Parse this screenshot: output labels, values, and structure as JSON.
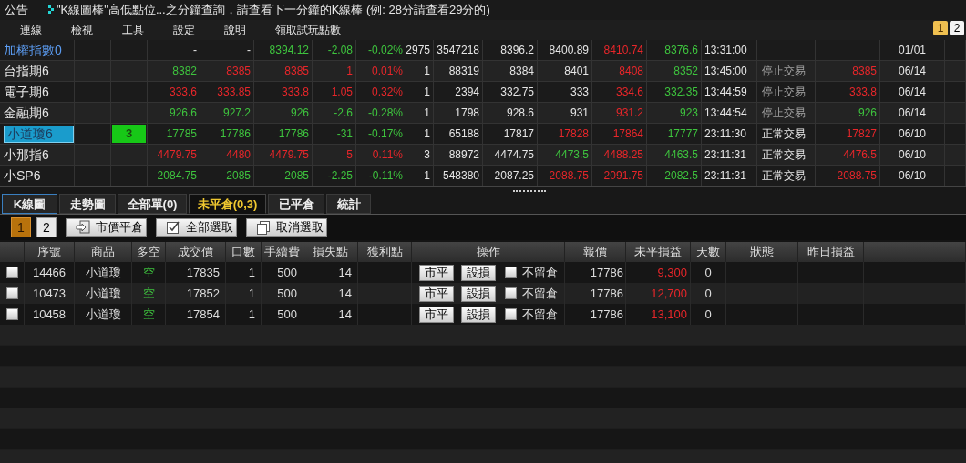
{
  "announcement": {
    "label": "公告",
    "text": "\"K線圖棒\"高低點位...之分鐘查詢，請查看下一分鐘的K線棒 (例: 28分請查看29分的)"
  },
  "menu": [
    "連線",
    "檢視",
    "工具",
    "設定",
    "說明",
    "領取試玩點數"
  ],
  "page_switch": [
    {
      "label": "1",
      "selected": true
    },
    {
      "label": "2",
      "selected": false
    }
  ],
  "quotes": [
    {
      "selected": false,
      "cells": [
        {
          "text": "加權指數0",
          "color": "#5b9bf0"
        },
        null,
        null,
        {
          "text": "-"
        },
        {
          "text": "-"
        },
        {
          "text": "8394.12",
          "color": "#3ec43e"
        },
        {
          "text": "-2.08",
          "color": "#3ec43e"
        },
        {
          "text": "-0.02%",
          "color": "#3ec43e"
        },
        {
          "text": "2975",
          "color": "#e6e6e6"
        },
        {
          "text": "3547218",
          "color": "#e6e6e6"
        },
        {
          "text": "8396.2",
          "color": "#e6e6e6"
        },
        {
          "text": "8400.89",
          "color": "#e6e6e6"
        },
        {
          "text": "8410.74",
          "color": "#e8262a"
        },
        {
          "text": "8376.6",
          "color": "#3ec43e"
        },
        {
          "text": "13:31:00",
          "color": "#e6e6e6"
        },
        null,
        null,
        {
          "text": "01/01",
          "color": "#e6e6e6"
        },
        null
      ]
    },
    {
      "selected": false,
      "cells": [
        {
          "text": "台指期6",
          "color": "#e6e6e6"
        },
        null,
        null,
        {
          "text": "8382",
          "color": "#3ec43e"
        },
        {
          "text": "8385",
          "color": "#e8262a"
        },
        {
          "text": "8385",
          "color": "#e8262a"
        },
        {
          "text": "1",
          "color": "#e8262a"
        },
        {
          "text": "0.01%",
          "color": "#e8262a"
        },
        {
          "text": "1",
          "color": "#e6e6e6"
        },
        {
          "text": "88319",
          "color": "#e6e6e6"
        },
        {
          "text": "8384",
          "color": "#e6e6e6"
        },
        {
          "text": "8401",
          "color": "#e6e6e6"
        },
        {
          "text": "8408",
          "color": "#e8262a"
        },
        {
          "text": "8352",
          "color": "#3ec43e"
        },
        {
          "text": "13:45:00",
          "color": "#e6e6e6"
        },
        {
          "text": "停止交易",
          "color": "#a0a0a0"
        },
        {
          "text": "8385",
          "color": "#e8262a"
        },
        {
          "text": "06/14",
          "color": "#e6e6e6"
        },
        null
      ]
    },
    {
      "selected": false,
      "cells": [
        {
          "text": "電子期6",
          "color": "#e6e6e6"
        },
        null,
        null,
        {
          "text": "333.6",
          "color": "#e8262a"
        },
        {
          "text": "333.85",
          "color": "#e8262a"
        },
        {
          "text": "333.8",
          "color": "#e8262a"
        },
        {
          "text": "1.05",
          "color": "#e8262a"
        },
        {
          "text": "0.32%",
          "color": "#e8262a"
        },
        {
          "text": "1",
          "color": "#e6e6e6"
        },
        {
          "text": "2394",
          "color": "#e6e6e6"
        },
        {
          "text": "332.75",
          "color": "#e6e6e6"
        },
        {
          "text": "333",
          "color": "#e6e6e6"
        },
        {
          "text": "334.6",
          "color": "#e8262a"
        },
        {
          "text": "332.35",
          "color": "#3ec43e"
        },
        {
          "text": "13:44:59",
          "color": "#e6e6e6"
        },
        {
          "text": "停止交易",
          "color": "#a0a0a0"
        },
        {
          "text": "333.8",
          "color": "#e8262a"
        },
        {
          "text": "06/14",
          "color": "#e6e6e6"
        },
        null
      ]
    },
    {
      "selected": false,
      "cells": [
        {
          "text": "金融期6",
          "color": "#e6e6e6"
        },
        null,
        null,
        {
          "text": "926.6",
          "color": "#3ec43e"
        },
        {
          "text": "927.2",
          "color": "#3ec43e"
        },
        {
          "text": "926",
          "color": "#3ec43e"
        },
        {
          "text": "-2.6",
          "color": "#3ec43e"
        },
        {
          "text": "-0.28%",
          "color": "#3ec43e"
        },
        {
          "text": "1",
          "color": "#e6e6e6"
        },
        {
          "text": "1798",
          "color": "#e6e6e6"
        },
        {
          "text": "928.6",
          "color": "#e6e6e6"
        },
        {
          "text": "931",
          "color": "#e6e6e6"
        },
        {
          "text": "931.2",
          "color": "#e8262a"
        },
        {
          "text": "923",
          "color": "#3ec43e"
        },
        {
          "text": "13:44:54",
          "color": "#e6e6e6"
        },
        {
          "text": "停止交易",
          "color": "#a0a0a0"
        },
        {
          "text": "926",
          "color": "#3ec43e"
        },
        {
          "text": "06/14",
          "color": "#e6e6e6"
        },
        null
      ]
    },
    {
      "selected": true,
      "cells": [
        {
          "text": "小道瓊6"
        },
        null,
        {
          "text": "3",
          "kind": "badge"
        },
        {
          "text": "17785",
          "color": "#3ec43e"
        },
        {
          "text": "17786",
          "color": "#3ec43e"
        },
        {
          "text": "17786",
          "color": "#3ec43e"
        },
        {
          "text": "-31",
          "color": "#3ec43e"
        },
        {
          "text": "-0.17%",
          "color": "#3ec43e"
        },
        {
          "text": "1",
          "color": "#e6e6e6"
        },
        {
          "text": "65188",
          "color": "#e6e6e6"
        },
        {
          "text": "17817",
          "color": "#e6e6e6"
        },
        {
          "text": "17828",
          "color": "#e8262a"
        },
        {
          "text": "17864",
          "color": "#e8262a"
        },
        {
          "text": "17777",
          "color": "#3ec43e"
        },
        {
          "text": "23:11:30",
          "color": "#e6e6e6"
        },
        {
          "text": "正常交易"
        },
        {
          "text": "17827",
          "color": "#e8262a"
        },
        {
          "text": "06/10",
          "color": "#e6e6e6"
        },
        null
      ]
    },
    {
      "selected": false,
      "cells": [
        {
          "text": "小那指6",
          "color": "#e6e6e6"
        },
        null,
        null,
        {
          "text": "4479.75",
          "color": "#e8262a"
        },
        {
          "text": "4480",
          "color": "#e8262a"
        },
        {
          "text": "4479.75",
          "color": "#e8262a"
        },
        {
          "text": "5",
          "color": "#e8262a"
        },
        {
          "text": "0.11%",
          "color": "#e8262a"
        },
        {
          "text": "3",
          "color": "#e6e6e6"
        },
        {
          "text": "88972",
          "color": "#e6e6e6"
        },
        {
          "text": "4474.75",
          "color": "#e6e6e6"
        },
        {
          "text": "4473.5",
          "color": "#3ec43e"
        },
        {
          "text": "4488.25",
          "color": "#e8262a"
        },
        {
          "text": "4463.5",
          "color": "#3ec43e"
        },
        {
          "text": "23:11:31",
          "color": "#e6e6e6"
        },
        {
          "text": "正常交易"
        },
        {
          "text": "4476.5",
          "color": "#e8262a"
        },
        {
          "text": "06/10",
          "color": "#e6e6e6"
        },
        null
      ]
    },
    {
      "selected": false,
      "cells": [
        {
          "text": "小SP6",
          "color": "#e6e6e6"
        },
        null,
        null,
        {
          "text": "2084.75",
          "color": "#3ec43e"
        },
        {
          "text": "2085",
          "color": "#3ec43e"
        },
        {
          "text": "2085",
          "color": "#3ec43e"
        },
        {
          "text": "-2.25",
          "color": "#3ec43e"
        },
        {
          "text": "-0.11%",
          "color": "#3ec43e"
        },
        {
          "text": "1",
          "color": "#e6e6e6"
        },
        {
          "text": "548380",
          "color": "#e6e6e6"
        },
        {
          "text": "2087.25",
          "color": "#e6e6e6"
        },
        {
          "text": "2088.75",
          "color": "#e8262a"
        },
        {
          "text": "2091.75",
          "color": "#e8262a"
        },
        {
          "text": "2082.5",
          "color": "#3ec43e"
        },
        {
          "text": "23:11:31",
          "color": "#e6e6e6"
        },
        {
          "text": "正常交易"
        },
        {
          "text": "2088.75",
          "color": "#e8262a"
        },
        {
          "text": "06/10",
          "color": "#e6e6e6"
        },
        null
      ]
    }
  ],
  "tabs": [
    {
      "label": "K線圖",
      "selected": false,
      "focused": true
    },
    {
      "label": "走勢圖",
      "selected": false,
      "focused": false
    },
    {
      "label": "全部單(0)",
      "selected": false,
      "focused": false
    },
    {
      "label": "未平倉(0,3)",
      "selected": true,
      "focused": false
    },
    {
      "label": "已平倉",
      "selected": false,
      "focused": false
    },
    {
      "label": "統計",
      "selected": false,
      "focused": false
    }
  ],
  "toolbar": {
    "pages": [
      {
        "label": "1",
        "selected": true
      },
      {
        "label": "2",
        "selected": false
      }
    ],
    "buttons": [
      {
        "label": "市價平倉",
        "kind": "close"
      },
      {
        "label": "全部選取",
        "kind": "select"
      },
      {
        "label": "取消選取",
        "kind": "clear"
      }
    ]
  },
  "positions": {
    "columns": [
      "序號",
      "商品",
      "多空",
      "成交價",
      "口數",
      "手續費",
      "損失點",
      "獲利點",
      "操作",
      "報價",
      "未平損益",
      "天數",
      "狀態",
      "昨日損益"
    ],
    "rows": [
      {
        "checked": false,
        "id": "14466",
        "product": "小道瓊",
        "side": "空",
        "price": "17835",
        "qty": "1",
        "fee": "500",
        "stop_loss": "14",
        "close_button": "市平",
        "stop_button": "設損",
        "no_overnight": {
          "label": "不留倉",
          "checked": false
        },
        "quote": "17786",
        "pnl": "9,300",
        "days": "0"
      },
      {
        "checked": false,
        "id": "10473",
        "product": "小道瓊",
        "side": "空",
        "price": "17852",
        "qty": "1",
        "fee": "500",
        "stop_loss": "14",
        "close_button": "市平",
        "stop_button": "設損",
        "no_overnight": {
          "label": "不留倉",
          "checked": false
        },
        "quote": "17786",
        "pnl": "12,700",
        "days": "0"
      },
      {
        "checked": false,
        "id": "10458",
        "product": "小道瓊",
        "side": "空",
        "price": "17854",
        "qty": "1",
        "fee": "500",
        "stop_loss": "14",
        "close_button": "市平",
        "stop_button": "設損",
        "no_overnight": {
          "label": "不留倉",
          "checked": false
        },
        "quote": "17786",
        "pnl": "13,100",
        "days": "0"
      }
    ]
  }
}
